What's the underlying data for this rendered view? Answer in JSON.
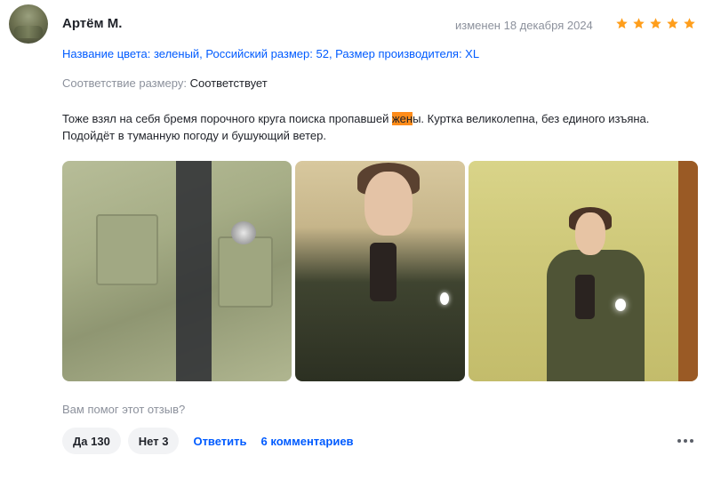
{
  "review": {
    "author": "Артём М.",
    "date": "изменен 18 декабря 2024",
    "rating": 5,
    "rating_color": "#ff9e1b",
    "variant": "Название цвета: зеленый, Российский размер: 52, Размер производителя: XL",
    "fit_label": "Соответствие размеру:",
    "fit_value": "Соответствует",
    "text_before": "Тоже взял на себя бремя порочного круга поиска пропавшей ",
    "text_highlight": "жен",
    "text_after": "ы. Куртка великолепна, без единого изъяна. Подойдёт в туманную погоду и бушующий ветер.",
    "photos": [
      "photo-jacket-closeup",
      "photo-mirror-selfie-1",
      "photo-mirror-selfie-2"
    ]
  },
  "footer": {
    "helpful_question": "Вам помог этот отзыв?",
    "yes_label": "Да 130",
    "no_label": "Нет 3",
    "reply_label": "Ответить",
    "comments_label": "6 комментариев",
    "more_icon": "more-dots-icon"
  },
  "colors": {
    "link": "#005bff",
    "highlight": "#ff8c1a",
    "muted": "#8c919c"
  }
}
